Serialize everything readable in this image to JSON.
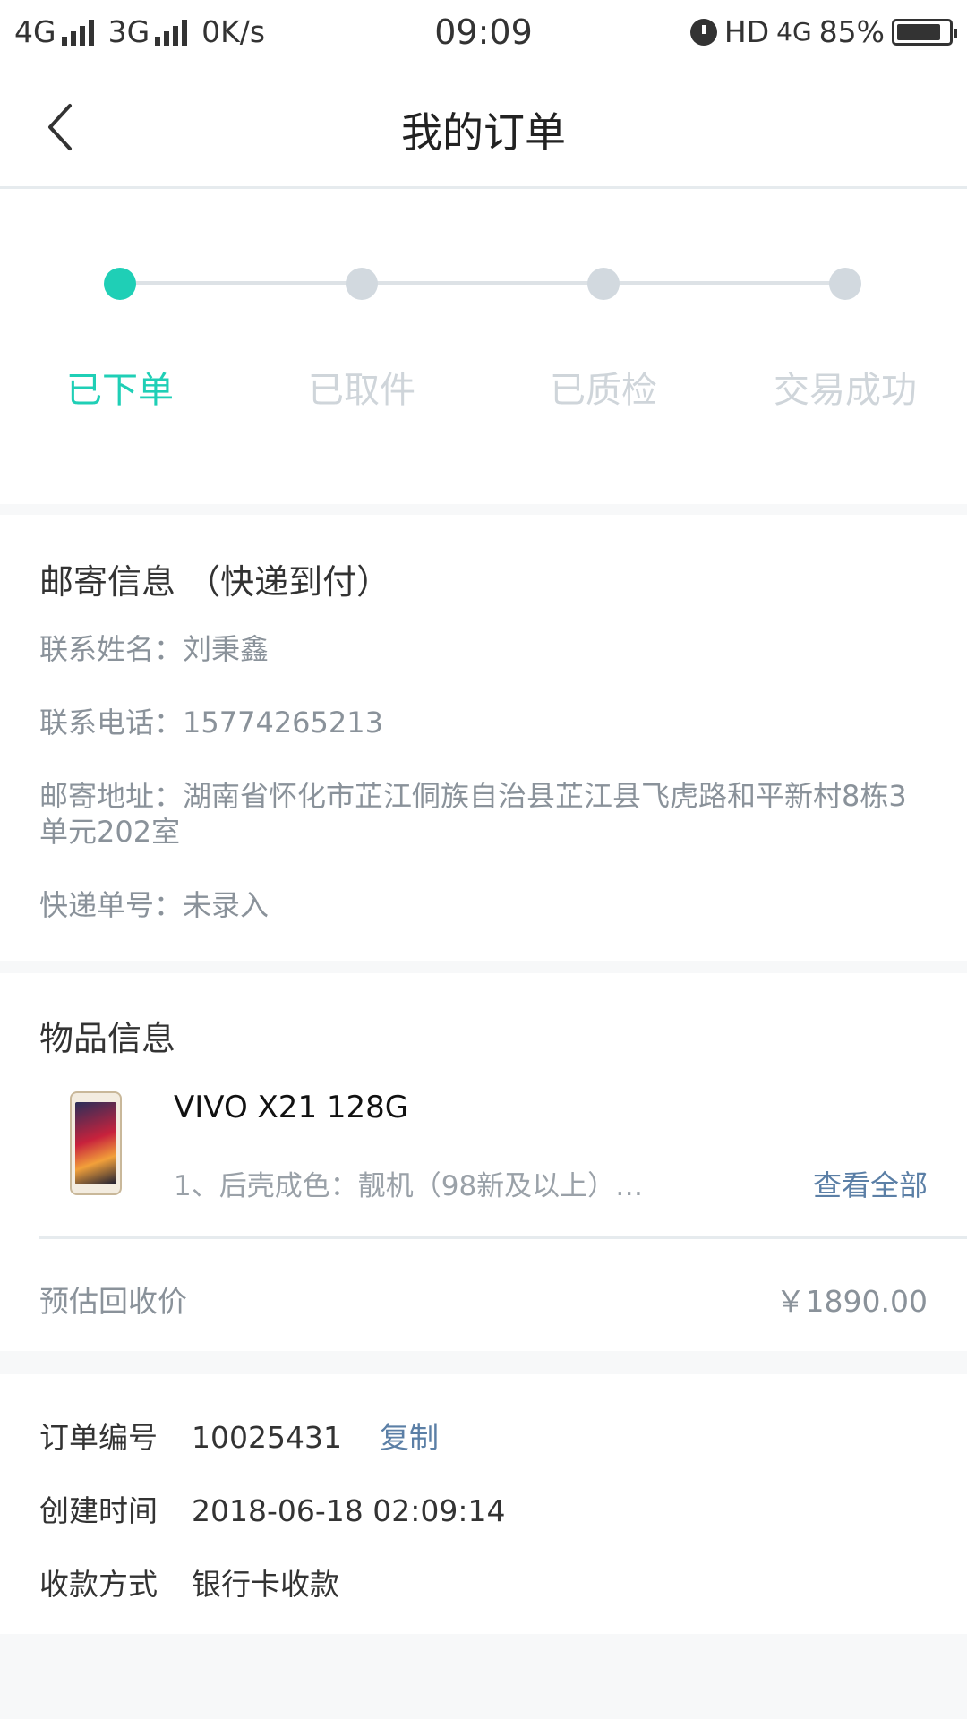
{
  "status_bar": {
    "network_left": "4G",
    "network_mid": "3G",
    "speed": "0K/s",
    "time": "09:09",
    "hd": "HD",
    "network_right": "4G",
    "battery": "85%",
    "battery_level": 0.85
  },
  "header": {
    "title": "我的订单"
  },
  "progress": {
    "steps": [
      {
        "label": "已下单",
        "active": true
      },
      {
        "label": "已取件",
        "active": false
      },
      {
        "label": "已质检",
        "active": false
      },
      {
        "label": "交易成功",
        "active": false
      }
    ],
    "accent": "#1fcfb6"
  },
  "shipping": {
    "title": "邮寄信息 （快递到付）",
    "name_label": "联系姓名：",
    "name": "刘秉鑫",
    "phone_label": "联系电话：",
    "phone": "15774265213",
    "address_label": "邮寄地址：",
    "address": "湖南省怀化市芷江侗族自治县芷江县飞虎路和平新村8栋3单元202室",
    "tracking_label": "快递单号：",
    "tracking": "未录入"
  },
  "item": {
    "title": "物品信息",
    "product_name": "VIVO X21 128G",
    "spec": "1、后壳成色：靓机（98新及以上）…",
    "see_all": "查看全部",
    "price_label": "预估回收价",
    "price": "￥1890.00"
  },
  "order": {
    "number_label": "订单编号",
    "number": "10025431",
    "copy": "复制",
    "created_label": "创建时间",
    "created": "2018-06-18 02:09:14",
    "payment_label": "收款方式",
    "payment": "银行卡收款"
  }
}
